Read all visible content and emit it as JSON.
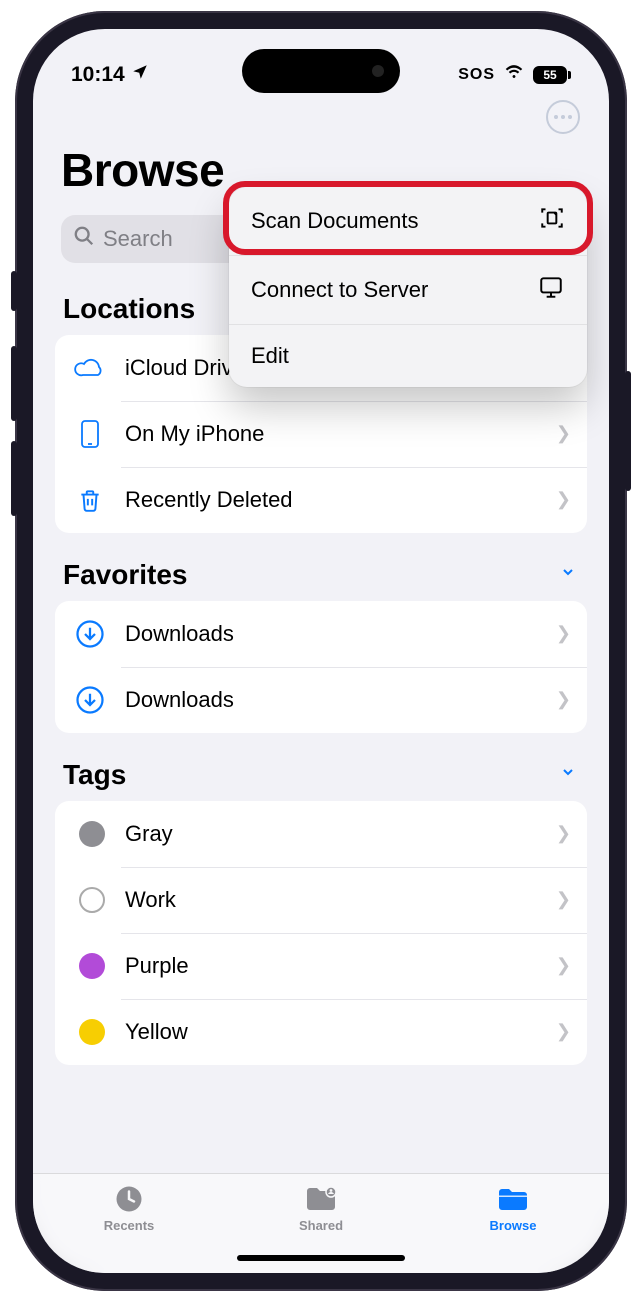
{
  "status": {
    "time": "10:14",
    "sos": "SOS",
    "battery": "55"
  },
  "header": {
    "title": "Browse"
  },
  "search": {
    "placeholder": "Search"
  },
  "popover": {
    "items": [
      {
        "label": "Scan Documents",
        "icon": "scan-document-icon"
      },
      {
        "label": "Connect to Server",
        "icon": "display-icon"
      },
      {
        "label": "Edit",
        "icon": ""
      }
    ]
  },
  "sections": {
    "locations": {
      "title": "Locations",
      "items": [
        {
          "label": "iCloud Drive",
          "icon": "cloud-icon"
        },
        {
          "label": "On My iPhone",
          "icon": "iphone-icon"
        },
        {
          "label": "Recently Deleted",
          "icon": "trash-icon"
        }
      ]
    },
    "favorites": {
      "title": "Favorites",
      "items": [
        {
          "label": "Downloads",
          "icon": "download-circle-icon"
        },
        {
          "label": "Downloads",
          "icon": "download-circle-icon"
        }
      ]
    },
    "tags": {
      "title": "Tags",
      "items": [
        {
          "label": "Gray",
          "color": "#8e8e93"
        },
        {
          "label": "Work",
          "color": "outline"
        },
        {
          "label": "Purple",
          "color": "#b24bd8"
        },
        {
          "label": "Yellow",
          "color": "#f7ce02"
        }
      ]
    }
  },
  "tabs": {
    "recents": "Recents",
    "shared": "Shared",
    "browse": "Browse"
  }
}
